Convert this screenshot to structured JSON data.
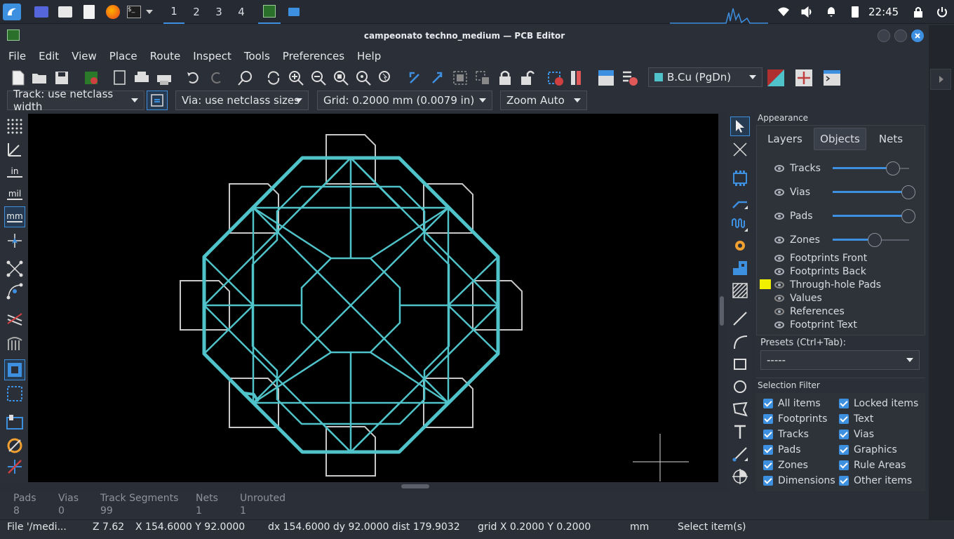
{
  "taskbar": {
    "workspaces": [
      "1",
      "2",
      "3",
      "4"
    ],
    "clock": "22:45"
  },
  "window": {
    "title": "campeonato techno_medium — PCB Editor"
  },
  "menu": [
    "File",
    "Edit",
    "View",
    "Place",
    "Route",
    "Inspect",
    "Tools",
    "Preferences",
    "Help"
  ],
  "toolbar": {
    "layer_select": "B.Cu (PgDn)",
    "track_width": "Track: use netclass width",
    "via_size": "Via: use netclass sizes",
    "grid": "Grid: 0.2000 mm (0.0079 in)",
    "zoom": "Zoom Auto"
  },
  "left_toolbar": {
    "unit_in": "in",
    "unit_mil": "mil",
    "unit_mm": "mm"
  },
  "appearance": {
    "title": "Appearance",
    "tabs": [
      "Layers",
      "Objects",
      "Nets"
    ],
    "active_tab": "Objects",
    "opacity_rows": [
      {
        "label": "Tracks",
        "value": 0.88
      },
      {
        "label": "Vias",
        "value": 1.0
      },
      {
        "label": "Pads",
        "value": 1.0
      },
      {
        "label": "Zones",
        "value": 0.55
      }
    ],
    "object_rows": [
      "Footprints Front",
      "Footprints Back",
      "Through-hole Pads",
      "Values",
      "References",
      "Footprint Text"
    ],
    "presets_label": "Presets (Ctrl+Tab):",
    "presets_value": "-----"
  },
  "selection_filter": {
    "title": "Selection Filter",
    "left": [
      "All items",
      "Footprints",
      "Tracks",
      "Pads",
      "Zones",
      "Dimensions"
    ],
    "right": [
      "Locked items",
      "Text",
      "Vias",
      "Graphics",
      "Rule Areas",
      "Other items"
    ]
  },
  "messages": {
    "stats": [
      {
        "label": "Pads",
        "value": "8"
      },
      {
        "label": "Vias",
        "value": "0"
      },
      {
        "label": "Track Segments",
        "value": "99"
      },
      {
        "label": "Nets",
        "value": "1"
      },
      {
        "label": "Unrouted",
        "value": "1"
      }
    ]
  },
  "status": {
    "file": "File '/medi...",
    "zoom": "Z 7.62",
    "xy": "X 154.6000  Y 92.0000",
    "delta": "dx 154.6000  dy 92.0000  dist 179.9032",
    "grid": "grid X 0.2000  Y 0.2000",
    "units": "mm",
    "mode": "Select item(s)"
  },
  "colors": {
    "track": "#4fc3c9",
    "footprint": "#c8c8c8",
    "accent": "#3d8fe0",
    "through_hole_swatch": "#f0f000"
  }
}
